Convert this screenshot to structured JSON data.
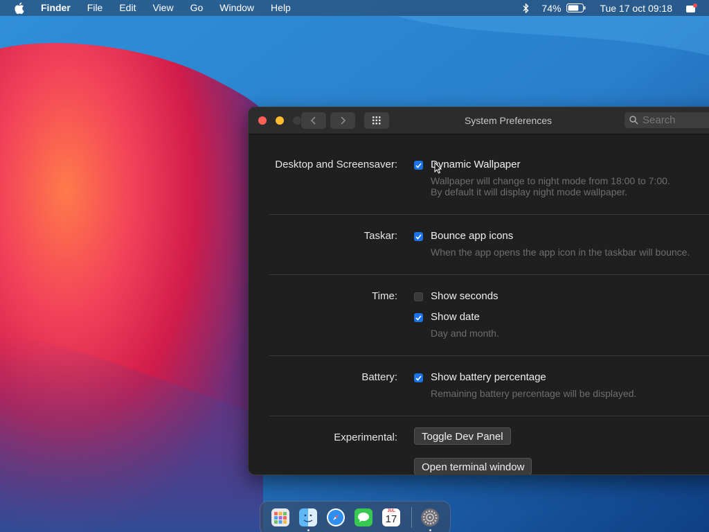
{
  "menubar": {
    "app_name": "Finder",
    "items": [
      "File",
      "Edit",
      "View",
      "Go",
      "Window",
      "Help"
    ],
    "battery_percent": "74%",
    "battery_level": 0.74,
    "datetime": "Tue 17 oct 09:18"
  },
  "window": {
    "title": "System Preferences",
    "search_placeholder": "Search"
  },
  "settings": {
    "desktop": {
      "label": "Desktop and Screensaver:",
      "option": "Dynamic Wallpaper",
      "checked": true,
      "desc1": "Wallpaper will change to night mode from 18:00 to 7:00.",
      "desc2": "By default it will display night mode wallpaper."
    },
    "taskbar": {
      "label": "Taskar:",
      "option": "Bounce app icons",
      "checked": true,
      "desc": "When the app opens the app icon in the taskbar will bounce."
    },
    "time": {
      "label": "Time:",
      "option1": "Show seconds",
      "option1_checked": false,
      "option2": "Show date",
      "option2_checked": true,
      "desc": "Day and month."
    },
    "battery": {
      "label": "Battery:",
      "option": "Show battery percentage",
      "checked": true,
      "desc": "Remaining battery percentage will be displayed."
    },
    "experimental": {
      "label": "Experimental:",
      "button1": "Toggle Dev Panel",
      "button2": "Open terminal window"
    }
  },
  "dock": {
    "items": [
      "launchpad-icon",
      "finder-icon",
      "safari-icon",
      "messages-icon",
      "calendar-icon",
      "system-preferences-icon"
    ],
    "calendar_month": "JUL",
    "calendar_day": "17"
  },
  "colors": {
    "accent": "#1a73e8",
    "close": "#ff5f57",
    "minimize": "#febc2e"
  }
}
